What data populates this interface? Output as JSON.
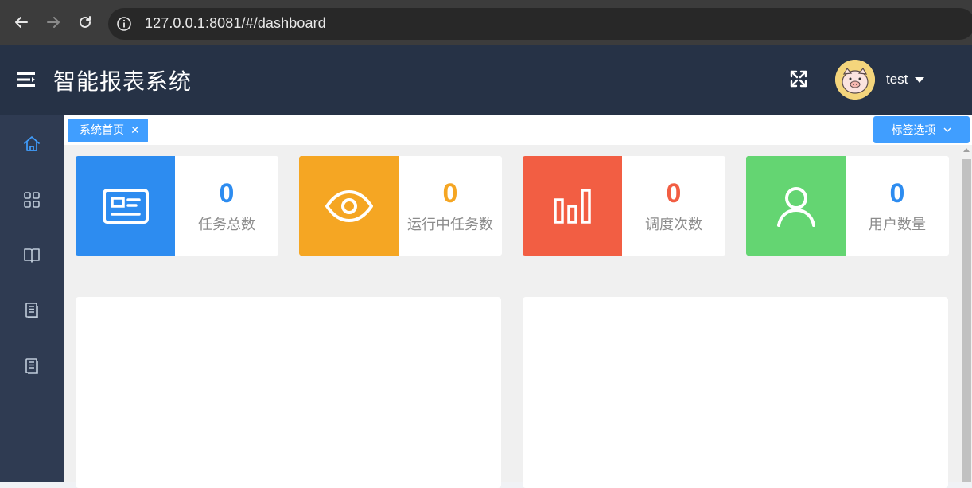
{
  "browser": {
    "url": "127.0.0.1:8081/#/dashboard"
  },
  "header": {
    "title": "智能报表系统",
    "username": "test"
  },
  "sidebar": {
    "items": [
      {
        "icon": "home-icon",
        "active": true
      },
      {
        "icon": "grid-icon",
        "active": false
      },
      {
        "icon": "book-icon",
        "active": false
      },
      {
        "icon": "document-icon",
        "active": false
      },
      {
        "icon": "document-icon",
        "active": false
      }
    ]
  },
  "tabs": {
    "active_label": "系统首页",
    "close_symbol": "✕",
    "options_label": "标签选项"
  },
  "stats": [
    {
      "value": "0",
      "label": "任务总数",
      "color": "#2d8cf0",
      "icon": "id-card-icon"
    },
    {
      "value": "0",
      "label": "运行中任务数",
      "color": "#f5a623",
      "icon": "eye-icon"
    },
    {
      "value": "0",
      "label": "调度次数",
      "color": "#f25e43",
      "icon": "bar-chart-icon"
    },
    {
      "value": "0",
      "label": "用户数量",
      "color": "#64d572",
      "icon": "user-icon"
    }
  ],
  "colors": {
    "header_bg": "#263246",
    "sidebar_bg": "#2f3b52",
    "accent": "#409eff"
  }
}
